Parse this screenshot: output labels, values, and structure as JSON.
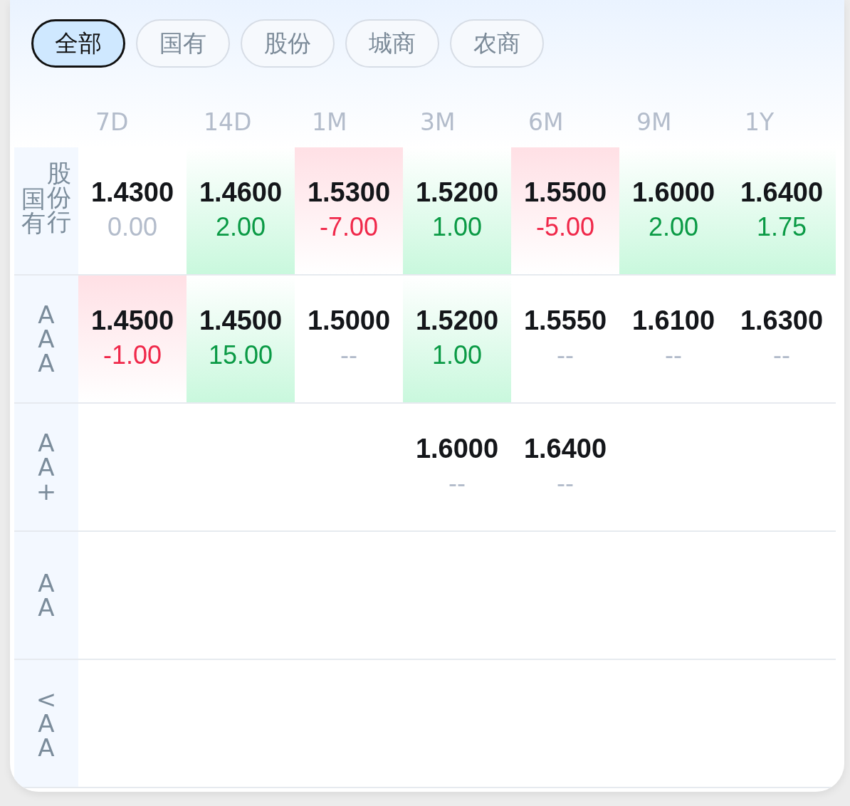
{
  "filters": [
    {
      "label": "全部",
      "selected": true
    },
    {
      "label": "国有",
      "selected": false
    },
    {
      "label": "股份",
      "selected": false
    },
    {
      "label": "城商",
      "selected": false
    },
    {
      "label": "农商",
      "selected": false
    }
  ],
  "columns": [
    "7D",
    "14D",
    "1M",
    "3M",
    "6M",
    "9M",
    "1Y"
  ],
  "rows": [
    {
      "label_columns": [
        "国有",
        "股份行"
      ],
      "cells": [
        {
          "value": "1.4300",
          "change": "0.00",
          "kind": "flat"
        },
        {
          "value": "1.4600",
          "change": "2.00",
          "kind": "up"
        },
        {
          "value": "1.5300",
          "change": "-7.00",
          "kind": "down"
        },
        {
          "value": "1.5200",
          "change": "1.00",
          "kind": "up"
        },
        {
          "value": "1.5500",
          "change": "-5.00",
          "kind": "down"
        },
        {
          "value": "1.6000",
          "change": "2.00",
          "kind": "up"
        },
        {
          "value": "1.6400",
          "change": "1.75",
          "kind": "up"
        }
      ]
    },
    {
      "label_columns": [
        "AAA"
      ],
      "cells": [
        {
          "value": "1.4500",
          "change": "-1.00",
          "kind": "down"
        },
        {
          "value": "1.4500",
          "change": "15.00",
          "kind": "up"
        },
        {
          "value": "1.5000",
          "change": "--",
          "kind": "none"
        },
        {
          "value": "1.5200",
          "change": "1.00",
          "kind": "up"
        },
        {
          "value": "1.5550",
          "change": "--",
          "kind": "none"
        },
        {
          "value": "1.6100",
          "change": "--",
          "kind": "none"
        },
        {
          "value": "1.6300",
          "change": "--",
          "kind": "none"
        }
      ]
    },
    {
      "label_columns": [
        "AA+"
      ],
      "cells": [
        null,
        null,
        null,
        {
          "value": "1.6000",
          "change": "--",
          "kind": "none"
        },
        {
          "value": "1.6400",
          "change": "--",
          "kind": "none"
        },
        null,
        null
      ]
    },
    {
      "label_columns": [
        "AA"
      ],
      "cells": [
        null,
        null,
        null,
        null,
        null,
        null,
        null
      ]
    },
    {
      "label_columns": [
        "<AA"
      ],
      "cells": [
        null,
        null,
        null,
        null,
        null,
        null,
        null
      ]
    }
  ]
}
